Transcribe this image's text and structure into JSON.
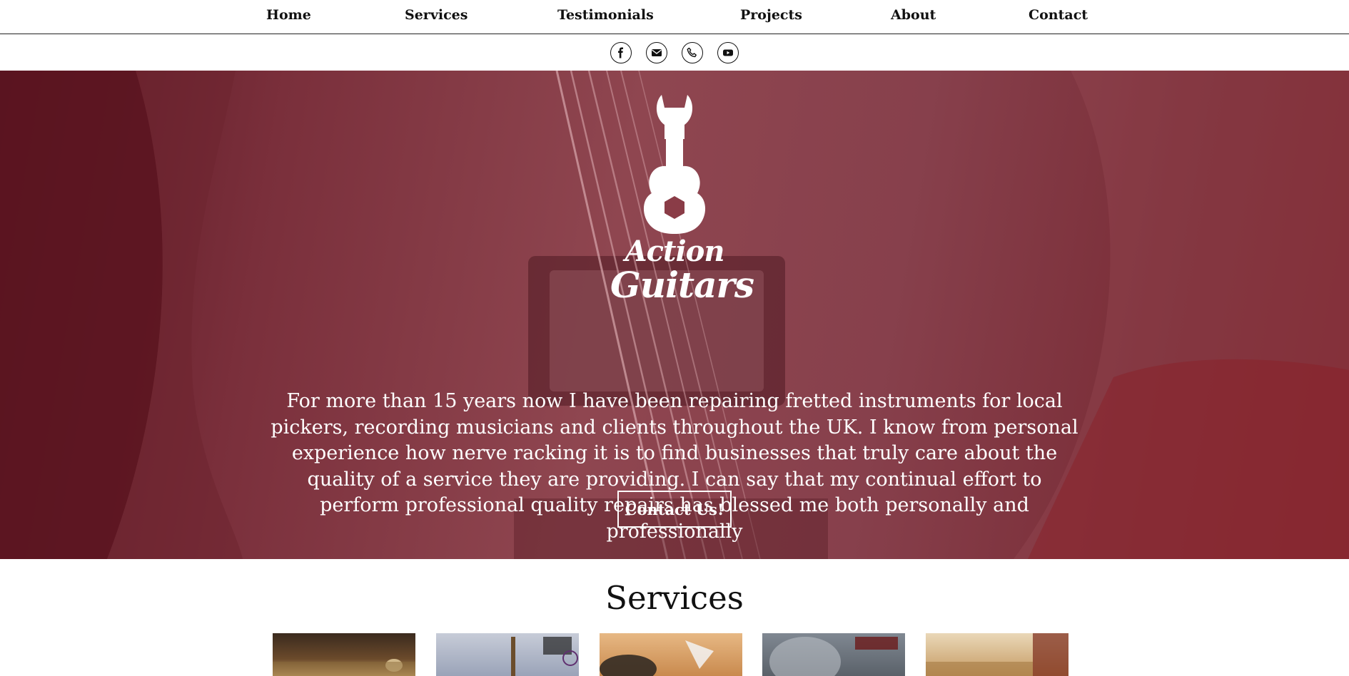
{
  "nav": {
    "items": [
      {
        "label": "Home"
      },
      {
        "label": "Services"
      },
      {
        "label": "Testimonials"
      },
      {
        "label": "Projects"
      },
      {
        "label": "About"
      },
      {
        "label": "Contact"
      }
    ]
  },
  "social": [
    "facebook-icon",
    "email-icon",
    "phone-icon",
    "youtube-icon"
  ],
  "hero": {
    "logo_line1": "Action",
    "logo_line2": "Guitars",
    "text_lines": [
      "For more than 15 years now I have been repairing fretted instruments for local",
      "pickers, recording musicians and clients throughout the UK. I know from personal",
      "experience how nerve racking it is to find businesses that truly care about the",
      "quality of a service they are providing. I can say that my continual effort to",
      "perform professional quality repairs has blessed me both personally and",
      "professionally"
    ],
    "cta_label": "Contact Us!"
  },
  "services": {
    "title": "Services"
  },
  "colors": {
    "hero_overlay": "#8a3c47",
    "nav_text": "#111111",
    "white": "#ffffff"
  }
}
